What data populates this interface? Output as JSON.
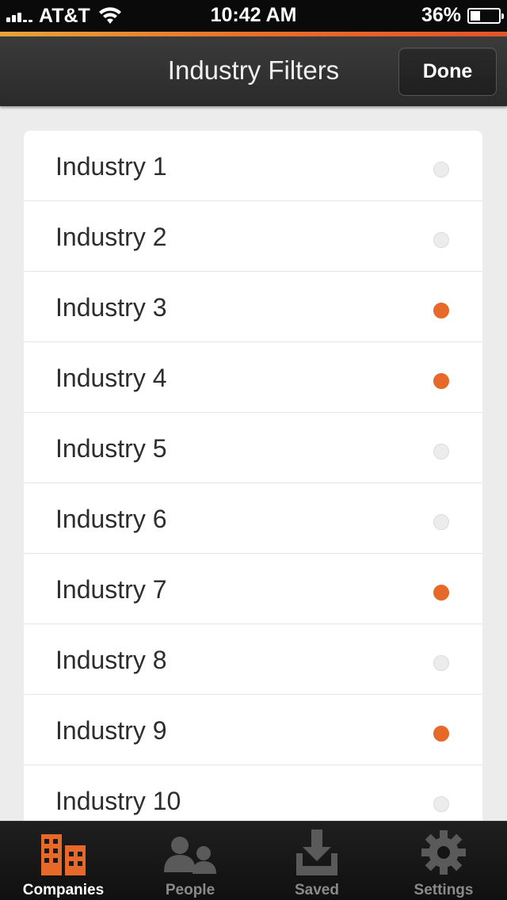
{
  "status_bar": {
    "carrier": "AT&T",
    "time": "10:42 AM",
    "battery": "36%"
  },
  "nav": {
    "title": "Industry Filters",
    "done_label": "Done"
  },
  "industries": [
    {
      "label": "Industry 1",
      "selected": false
    },
    {
      "label": "Industry 2",
      "selected": false
    },
    {
      "label": "Industry 3",
      "selected": true
    },
    {
      "label": "Industry 4",
      "selected": true
    },
    {
      "label": "Industry 5",
      "selected": false
    },
    {
      "label": "Industry 6",
      "selected": false
    },
    {
      "label": "Industry 7",
      "selected": true
    },
    {
      "label": "Industry 8",
      "selected": false
    },
    {
      "label": "Industry 9",
      "selected": true
    },
    {
      "label": "Industry 10",
      "selected": false
    }
  ],
  "tabs": [
    {
      "label": "Companies",
      "icon": "buildings-icon",
      "active": true
    },
    {
      "label": "People",
      "icon": "people-icon",
      "active": false
    },
    {
      "label": "Saved",
      "icon": "download-tray-icon",
      "active": false
    },
    {
      "label": "Settings",
      "icon": "gear-icon",
      "active": false
    }
  ],
  "colors": {
    "accent": "#e6692a",
    "nav_bg": "#333333",
    "background": "#ececec"
  }
}
